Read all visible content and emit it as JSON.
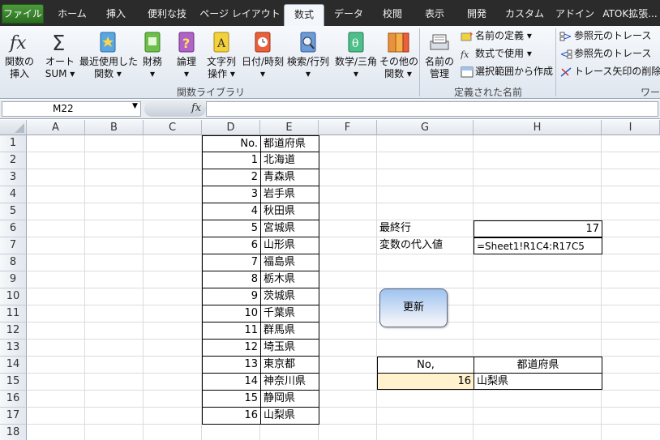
{
  "ribbon_tabs": [
    "ファイル",
    "ホーム",
    "挿入",
    "便利な技",
    "ページ レイアウト",
    "数式",
    "データ",
    "校閲",
    "表示",
    "開発",
    "カスタム",
    "アドイン",
    "ATOK拡張..."
  ],
  "active_tab": "数式",
  "ribbon": {
    "buttons": [
      {
        "label1": "関数の",
        "label2": "挿入",
        "icon": "fx-icon"
      },
      {
        "label1": "オート",
        "label2": "SUM ▾",
        "icon": "sigma-icon"
      },
      {
        "label1": "最近使用した",
        "label2": "関数 ▾",
        "icon": "book-star-icon"
      },
      {
        "label1": "財務",
        "label2": "▾",
        "icon": "book-money-icon"
      },
      {
        "label1": "論理",
        "label2": "▾",
        "icon": "book-question-icon"
      },
      {
        "label1": "文字列",
        "label2": "操作 ▾",
        "icon": "book-text-icon"
      },
      {
        "label1": "日付/時刻",
        "label2": "▾",
        "icon": "book-clock-icon"
      },
      {
        "label1": "検索/行列",
        "label2": "▾",
        "icon": "book-search-icon"
      },
      {
        "label1": "数学/三角",
        "label2": "▾",
        "icon": "book-theta-icon"
      },
      {
        "label1": "その他の",
        "label2": "関数 ▾",
        "icon": "books-icon"
      },
      {
        "label1": "名前の",
        "label2": "管理",
        "icon": "name-manager-icon"
      }
    ],
    "group_function_library": "関数ライブラリ",
    "group_defined_names": "定義された名前",
    "group_audit_partial": "ワー",
    "defined_names_items": [
      "名前の定義 ▾",
      "数式で使用 ▾",
      "選択範囲から作成"
    ],
    "audit_items": [
      "参照元のトレース",
      "参照先のトレース",
      "トレース矢印の削除 ▾"
    ]
  },
  "formula_bar": {
    "name_box": "M22",
    "fx_label": "fx",
    "formula": ""
  },
  "grid": {
    "columns": [
      "A",
      "B",
      "C",
      "D",
      "E",
      "F",
      "G",
      "H",
      "I"
    ],
    "rows": [
      "1",
      "2",
      "3",
      "4",
      "5",
      "6",
      "7",
      "8",
      "9",
      "10",
      "11",
      "12",
      "13",
      "14",
      "15",
      "16",
      "17",
      "18"
    ]
  },
  "table": {
    "header_no": "No.",
    "header_pref": "都道府県",
    "rows": [
      {
        "no": "1",
        "pref": "北海道"
      },
      {
        "no": "2",
        "pref": "青森県"
      },
      {
        "no": "3",
        "pref": "岩手県"
      },
      {
        "no": "4",
        "pref": "秋田県"
      },
      {
        "no": "5",
        "pref": "宮城県"
      },
      {
        "no": "6",
        "pref": "山形県"
      },
      {
        "no": "7",
        "pref": "福島県"
      },
      {
        "no": "8",
        "pref": "栃木県"
      },
      {
        "no": "9",
        "pref": "茨城県"
      },
      {
        "no": "10",
        "pref": "千葉県"
      },
      {
        "no": "11",
        "pref": "群馬県"
      },
      {
        "no": "12",
        "pref": "埼玉県"
      },
      {
        "no": "13",
        "pref": "東京都"
      },
      {
        "no": "14",
        "pref": "神奈川県"
      },
      {
        "no": "15",
        "pref": "静岡県"
      },
      {
        "no": "16",
        "pref": "山梨県"
      }
    ]
  },
  "info": {
    "last_row_label": "最終行",
    "last_row_value": "17",
    "assign_label": "変数の代入値",
    "assign_value": "=Sheet1!R1C4:R17C5"
  },
  "update_button": "更新",
  "result": {
    "header_no": "No,",
    "header_pref": "都道府県",
    "no_value": "16",
    "pref_value": "山梨県",
    "highlight_color": "#fff2cc"
  }
}
